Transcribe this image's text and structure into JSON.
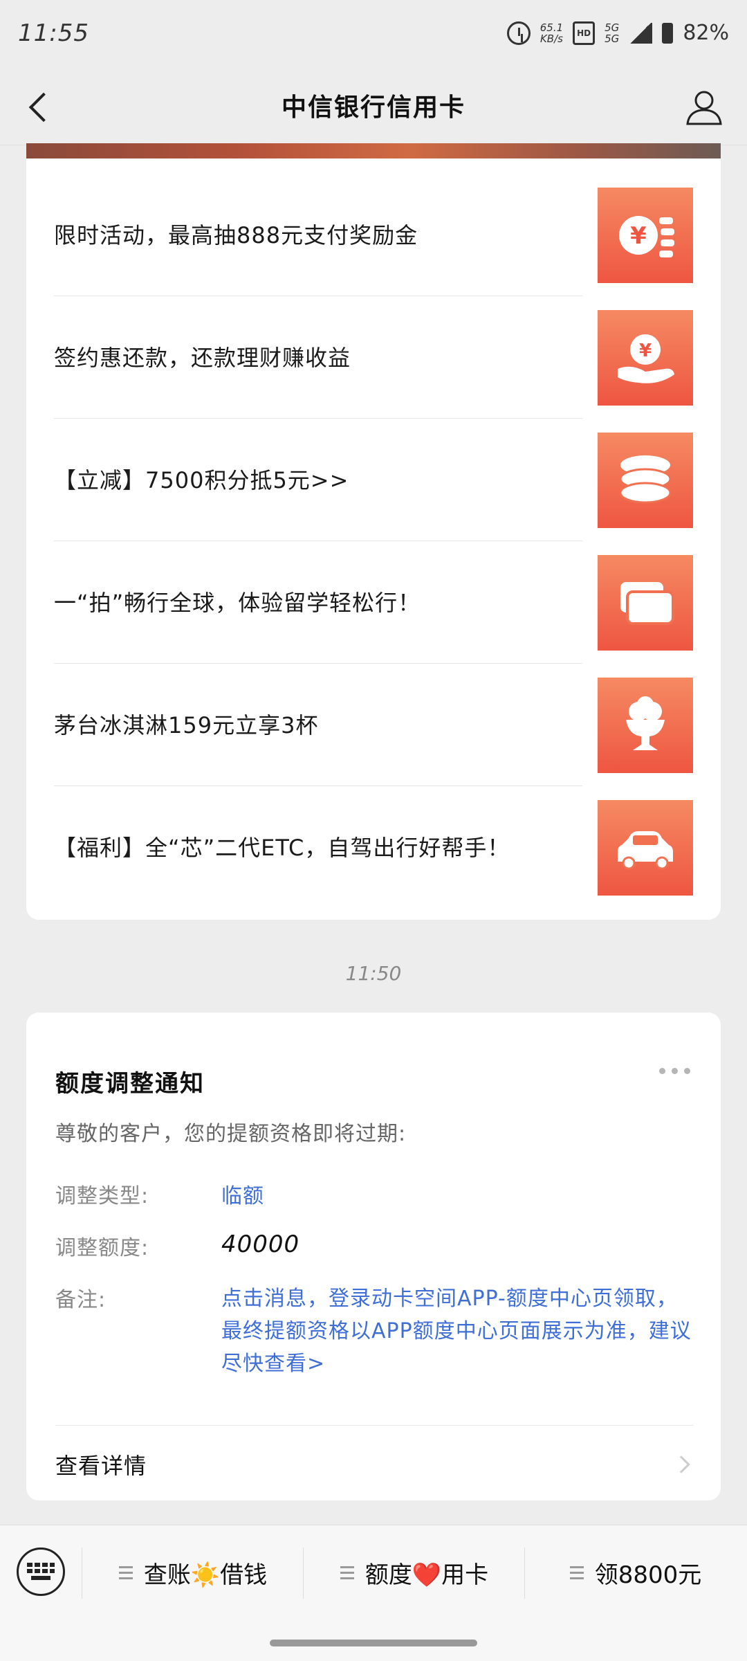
{
  "status_bar": {
    "time": "11:55",
    "net_speed_value": "65.1",
    "net_speed_unit": "KB/s",
    "hd_label": "HD",
    "network_a": "5G",
    "network_b": "5G",
    "battery": "82%"
  },
  "header": {
    "title": "中信银行信用卡"
  },
  "articles": [
    {
      "title": "限时活动，最高抽888元支付奖励金",
      "icon": "yen-coins-icon"
    },
    {
      "title": "签约惠还款，还款理财赚收益",
      "icon": "hand-yen-icon"
    },
    {
      "title": "【立减】7500积分抵5元>>",
      "icon": "coin-stack-icon"
    },
    {
      "title": "一“拍”畅行全球，体验留学轻松行！",
      "icon": "cards-icon"
    },
    {
      "title": "茅台冰淇淋159元立享3杯",
      "icon": "ice-cream-icon"
    },
    {
      "title": "【福利】全“芯”二代ETC，自驾出行好帮手！",
      "icon": "car-icon"
    }
  ],
  "timestamp": "11:50",
  "notice": {
    "title": "额度调整通知",
    "subtitle": "尊敬的客户，您的提额资格即将过期:",
    "rows": [
      {
        "key": "调整类型:",
        "value": "临额"
      },
      {
        "key": "调整额度:",
        "value": "40000"
      },
      {
        "key": "备注:",
        "value": "点击消息，登录动卡空间APP-额度中心页领取，最终提额资格以APP额度中心页面展示为准，建议尽快查看>"
      }
    ],
    "detail_label": "查看详情"
  },
  "bottom_menu": {
    "items": [
      {
        "label": "查账☀️借钱"
      },
      {
        "label": "额度❤️用卡"
      },
      {
        "label": "领8800元"
      }
    ]
  },
  "colors": {
    "accent_orange": "#ee5642",
    "link_blue": "#3f6fd6"
  }
}
